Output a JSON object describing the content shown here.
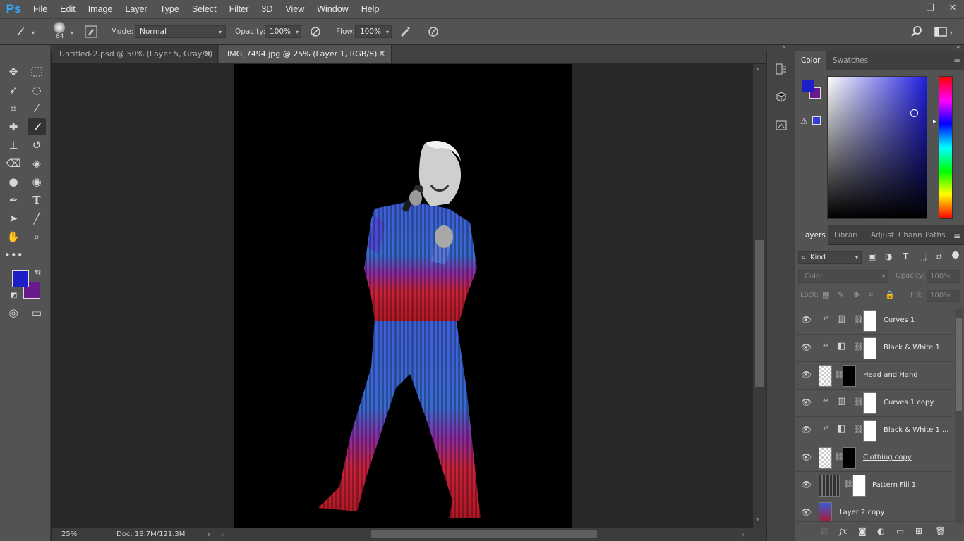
{
  "app": {
    "logo": "Ps"
  },
  "menu": [
    "File",
    "Edit",
    "Image",
    "Layer",
    "Type",
    "Select",
    "Filter",
    "3D",
    "View",
    "Window",
    "Help"
  ],
  "window_controls": {
    "minimize": "—",
    "restore": "❐",
    "close": "✕"
  },
  "options": {
    "brush_size": "84",
    "mode_label": "Mode:",
    "mode_value": "Normal",
    "opacity_label": "Opacity:",
    "opacity_value": "100%",
    "flow_label": "Flow:",
    "flow_value": "100%"
  },
  "tabs": [
    {
      "label": "Untitled-2.psd @ 50% (Layer 5, Gray/8)",
      "active": false
    },
    {
      "label": "IMG_7494.jpg @ 25% (Layer 1, RGB/8) *",
      "active": true
    }
  ],
  "colors": {
    "foreground": "#1e1ec8",
    "background": "#6a1a8c",
    "ui_bg": "#535353",
    "canvas_bg": "#000000"
  },
  "status": {
    "zoom": "25%",
    "doc": "Doc: 18.7M/121.3M"
  },
  "color_panel": {
    "tabs": [
      "Color",
      "Swatches"
    ]
  },
  "layers_panel": {
    "tabs": [
      "Layers",
      "Librari",
      "Adjust",
      "Chann",
      "Paths"
    ],
    "filter_kind": "Kind",
    "blend_mode": "Color",
    "opacity_label": "Opacity:",
    "opacity_value": "100%",
    "lock_label": "Lock:",
    "fill_label": "Fill:",
    "fill_value": "100%",
    "layers": [
      {
        "name": "Curves 1",
        "kind": "curves",
        "clipped": true,
        "underline": false
      },
      {
        "name": "Black & White 1",
        "kind": "bw",
        "clipped": true,
        "underline": false
      },
      {
        "name": "Head and Hand",
        "kind": "pixel-mask",
        "clipped": false,
        "underline": true
      },
      {
        "name": "Curves 1 copy",
        "kind": "curves",
        "clipped": true,
        "underline": false
      },
      {
        "name": "Black & White 1 ...",
        "kind": "bw",
        "clipped": true,
        "underline": false
      },
      {
        "name": "Clothing copy",
        "kind": "pixel-mask",
        "clipped": false,
        "underline": true
      },
      {
        "name": "Pattern Fill 1",
        "kind": "pattern",
        "clipped": false,
        "underline": false
      },
      {
        "name": "Layer 2 copy",
        "kind": "pixel",
        "clipped": false,
        "underline": false
      }
    ]
  }
}
